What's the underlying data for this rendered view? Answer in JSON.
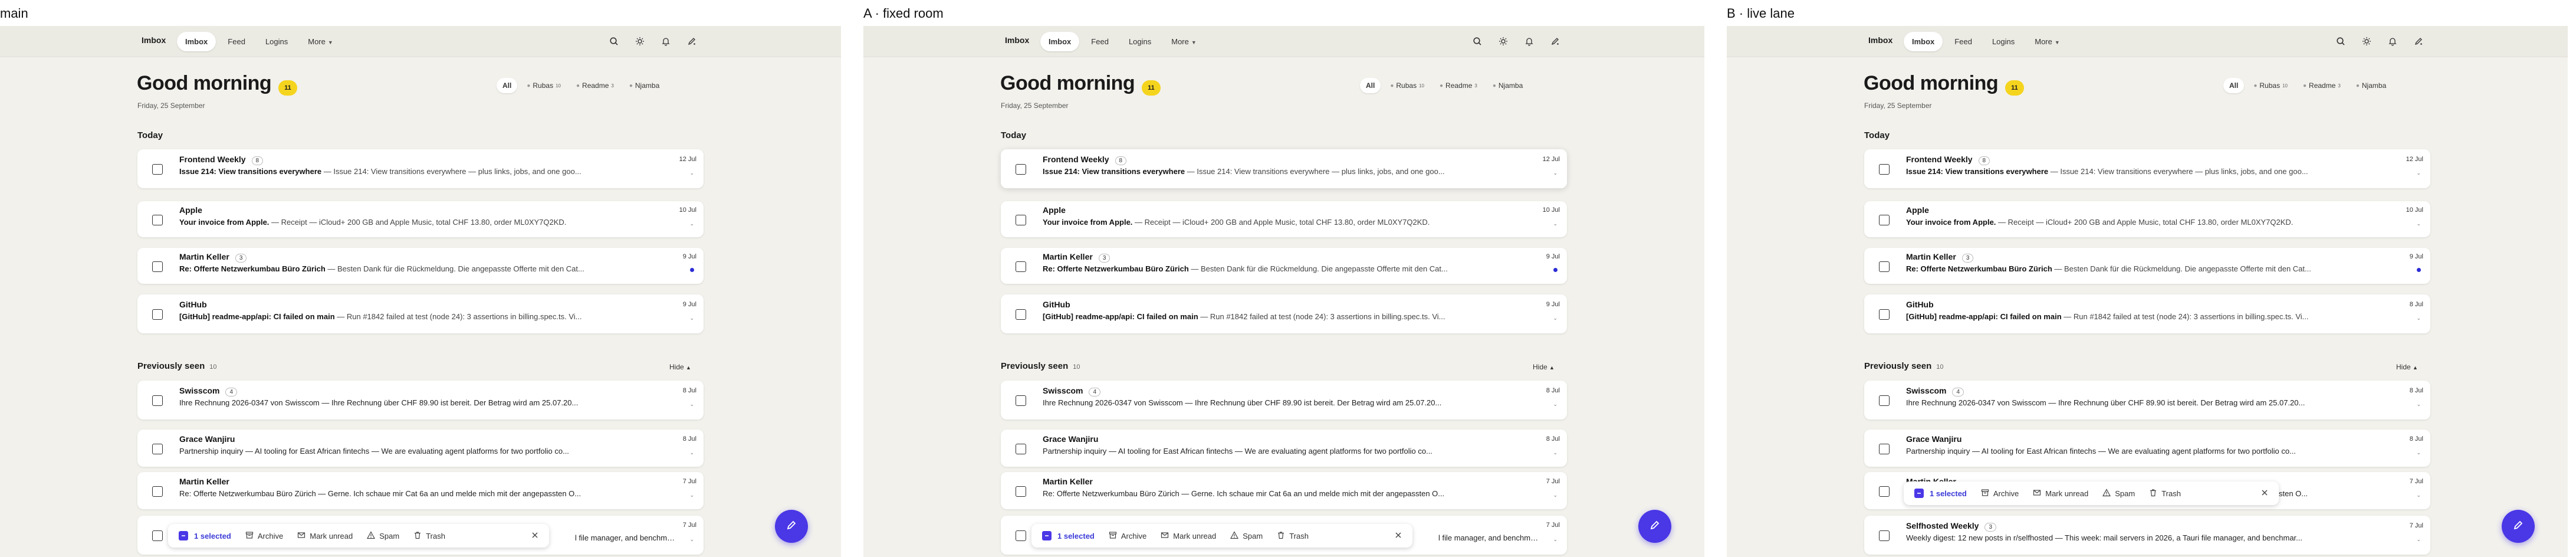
{
  "panels": [
    {
      "title": "main"
    },
    {
      "title": "A · fixed room"
    },
    {
      "title": "B · live lane"
    }
  ],
  "app": {
    "brand": "Imbox",
    "nav": [
      "Imbox",
      "Feed",
      "Logins",
      "More"
    ],
    "greeting": "Good morning",
    "greeting_badge": "11",
    "date": "Friday, 25 September",
    "filters": [
      {
        "label": "All"
      },
      {
        "label": "Rubas",
        "count": "10"
      },
      {
        "label": "Readme",
        "count": "3"
      },
      {
        "label": "Njamba"
      }
    ],
    "today_label": "Today",
    "previously_label": "Previously seen",
    "previously_count": "10",
    "hide_label": "Hide",
    "accent": "#4a37e6",
    "badge_color": "#f5d41e"
  },
  "today": [
    {
      "sender": "Frontend Weekly",
      "count": "8",
      "subject": "Issue 214: View transitions everywhere",
      "preview": " — Issue 214: View transitions everywhere — plus links, jobs, and one goo...",
      "date": "12 Jul",
      "unread": false
    },
    {
      "sender": "Apple",
      "count": "",
      "subject": "Your invoice from Apple.",
      "preview": " — Receipt — iCloud+ 200 GB and Apple Music, total CHF 13.80, order ML0XY7Q2KD.",
      "date": "10 Jul",
      "unread": false
    },
    {
      "sender": "Martin Keller",
      "count": "3",
      "subject": "Re: Offerte Netzwerkumbau Büro Zürich",
      "preview": " — Besten Dank für die Rückmeldung. Die angepasste Offerte mit den Cat...",
      "date": "9 Jul",
      "unread": true
    },
    {
      "sender": "GitHub",
      "count": "",
      "subject": "[GitHub] readme-app/api: CI failed on main",
      "preview": " — Run #1842 failed at test (node 24): 3 assertions in billing.spec.ts. Vi...",
      "date": "9 Jul",
      "unread": false
    }
  ],
  "today_b4": {
    "date": "8 Jul"
  },
  "previously": [
    {
      "sender": "Swisscom",
      "count": "4",
      "subject": "",
      "preview": "Ihre Rechnung 2026-0347 von Swisscom — Ihre Rechnung über CHF 89.90 ist bereit. Der Betrag wird am 25.07.20...",
      "date": "8 Jul"
    },
    {
      "sender": "Grace Wanjiru",
      "count": "",
      "subject": "",
      "preview": "Partnership inquiry — AI tooling for East African fintechs — We are evaluating agent platforms for two portfolio co...",
      "date": "8 Jul"
    },
    {
      "sender": "Martin Keller",
      "count": "",
      "subject": "",
      "preview": "Re: Offerte Netzwerkumbau Büro Zürich — Gerne. Ich schaue mir Cat 6a an und melde mich mit der angepassten O...",
      "date": "7 Jul"
    },
    {
      "sender": "Selfhosted Weekly",
      "count": "3",
      "subject": "",
      "preview": "Weekly digest: 12 new posts in r/selfhosted — This week: mail servers in 2026, a Tauri file manager, and benchmar...",
      "date": "7 Jul"
    }
  ],
  "hidden_tail": "l file manager, and benchmar...",
  "selection": {
    "count_label": "1 selected",
    "archive": "Archive",
    "mark_unread": "Mark unread",
    "spam": "Spam",
    "trash": "Trash"
  }
}
